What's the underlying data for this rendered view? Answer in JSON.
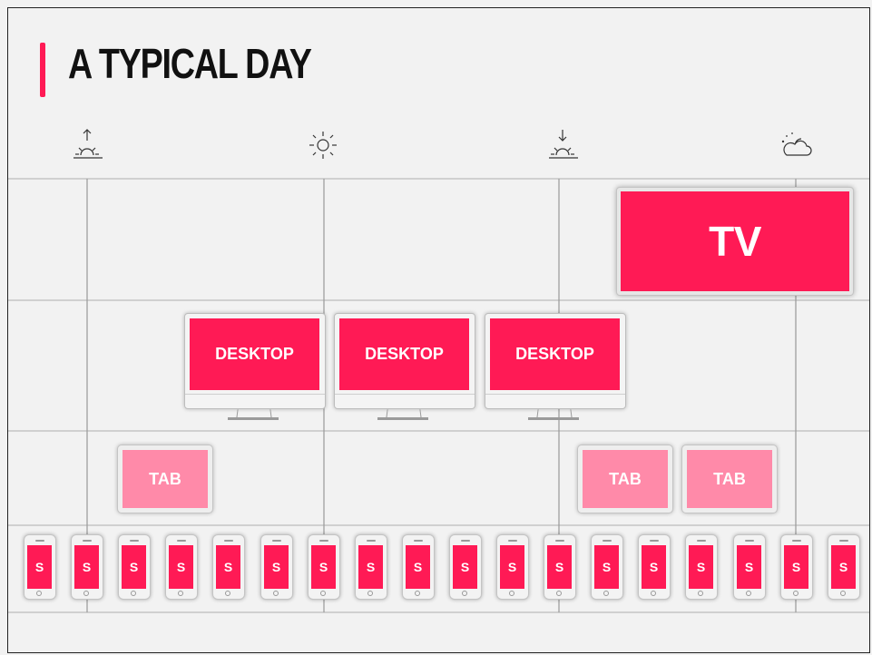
{
  "title": "A TYPICAL DAY",
  "colors": {
    "accent": "#ff1a55",
    "tablet": "#ff8aa9",
    "grid": "#bdbdbd",
    "frame": "#222222"
  },
  "time_icons": [
    "sunrise-icon",
    "sun-icon",
    "sunset-icon",
    "night-cloud-icon"
  ],
  "devices": {
    "tv": {
      "label": "TV"
    },
    "desktops": [
      {
        "label": "DESKTOP"
      },
      {
        "label": "DESKTOP"
      },
      {
        "label": "DESKTOP"
      }
    ],
    "tablets": [
      {
        "label": "TAB"
      },
      {
        "label": "TAB"
      },
      {
        "label": "TAB"
      }
    ],
    "phones": [
      {
        "label": "S"
      },
      {
        "label": "S"
      },
      {
        "label": "S"
      },
      {
        "label": "S"
      },
      {
        "label": "S"
      },
      {
        "label": "S"
      },
      {
        "label": "S"
      },
      {
        "label": "S"
      },
      {
        "label": "S"
      },
      {
        "label": "S"
      },
      {
        "label": "S"
      },
      {
        "label": "S"
      },
      {
        "label": "S"
      },
      {
        "label": "S"
      },
      {
        "label": "S"
      },
      {
        "label": "S"
      },
      {
        "label": "S"
      },
      {
        "label": "S"
      }
    ]
  }
}
